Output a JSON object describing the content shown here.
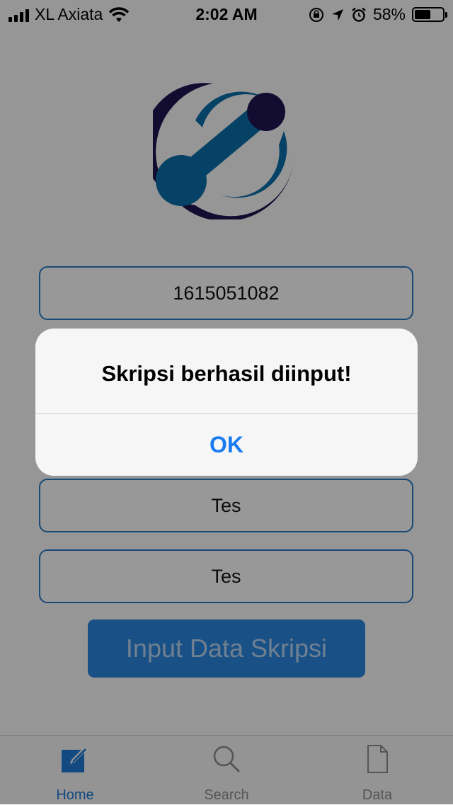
{
  "status_bar": {
    "carrier": "XL Axiata",
    "time": "2:02 AM",
    "battery": "58%",
    "battery_level": 0.58
  },
  "form": {
    "nim": "1615051082",
    "field3": "Tes",
    "field4": "Tes",
    "submit_label": "Input Data Skripsi"
  },
  "tabs": [
    {
      "label": "Home",
      "icon": "compose-icon",
      "active": true
    },
    {
      "label": "Search",
      "icon": "search-icon",
      "active": false
    },
    {
      "label": "Data",
      "icon": "document-icon",
      "active": false
    }
  ],
  "alert": {
    "title": "Skripsi berhasil diinput!",
    "ok_label": "OK"
  },
  "colors": {
    "accent": "#1e7bd7",
    "field_border": "#2a7ac4",
    "button": "#2a86e0",
    "logo_dark": "#1f1450",
    "logo_blue": "#0a6ea8"
  }
}
